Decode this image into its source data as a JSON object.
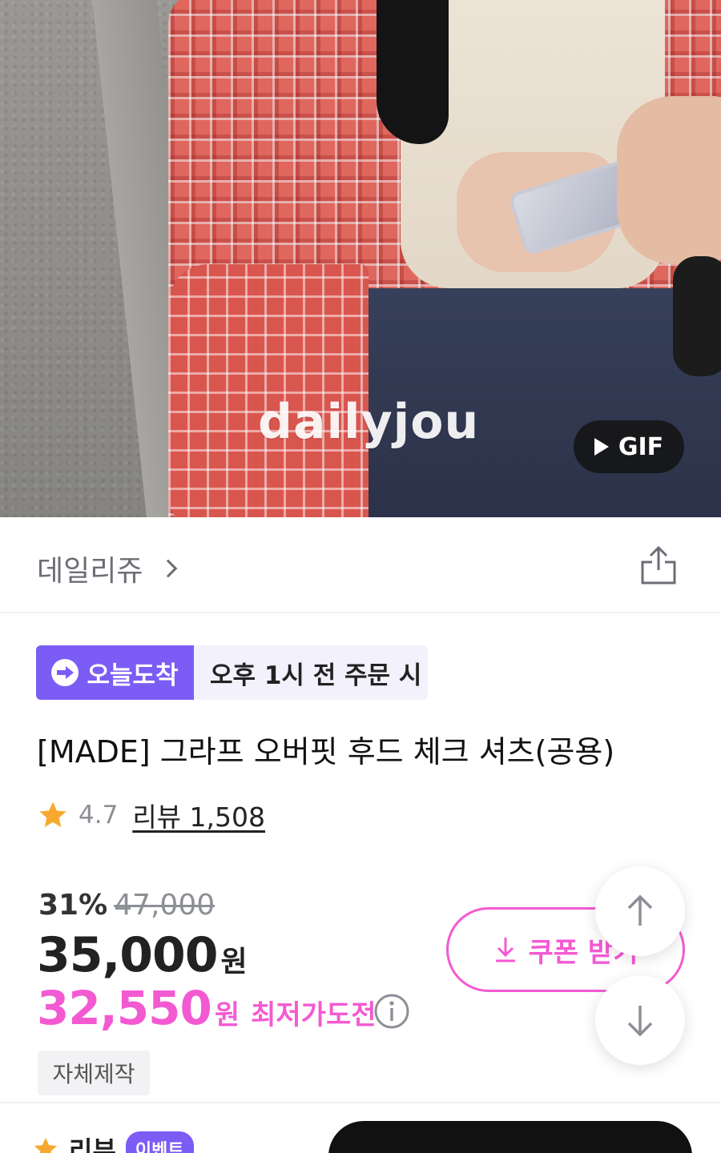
{
  "hero": {
    "watermark": "dailyjou",
    "gif_label": "GIF"
  },
  "brand": {
    "name": "데일리쥬"
  },
  "delivery": {
    "tag": "오늘도착",
    "note": "오후 1시 전 주문 시"
  },
  "product": {
    "title": "[MADE] 그라프 오버핏 후드 체크 셔츠(공용)",
    "rating": "4.7",
    "reviews": "리뷰 1,508"
  },
  "price": {
    "discount": "31%",
    "original": "47,000",
    "current": "35,000",
    "currency": "원",
    "best": "32,550",
    "best_currency": "원",
    "best_label": "최저가도전"
  },
  "coupon": {
    "label": "쿠폰 받기"
  },
  "tags": {
    "self_made": "자체제작"
  },
  "bottom": {
    "review_label": "리뷰",
    "event_badge": "이벤트"
  },
  "colors": {
    "accent_purple": "#7b5cf5",
    "accent_pink": "#f35ad2",
    "star": "#f7a92f"
  },
  "icons": [
    "share-icon",
    "chevron-right-icon",
    "play-icon",
    "star-icon",
    "info-icon",
    "download-icon",
    "arrow-up-icon",
    "arrow-down-icon"
  ]
}
